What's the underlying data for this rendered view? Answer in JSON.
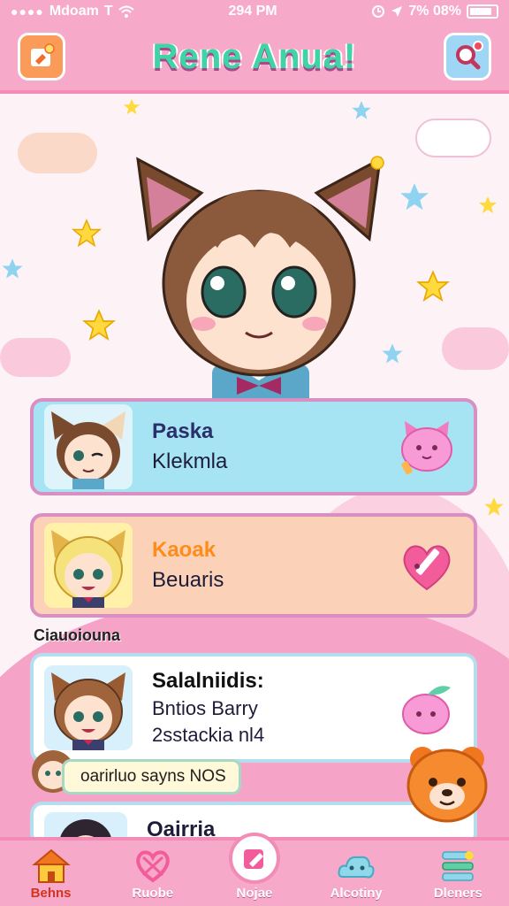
{
  "status_bar": {
    "carrier": "Mdoam",
    "carrier_mark": "T",
    "time": "294 PM",
    "battery_text": "7% 08%"
  },
  "header": {
    "title": "Rene Anua!",
    "left_icon": "edit-note-icon",
    "right_icon": "search-icon"
  },
  "cards": [
    {
      "name": "Paska",
      "subtitle": "Klekmla",
      "avatar": "cat-girl-avatar",
      "icon": "pink-cat-icon"
    },
    {
      "name": "Kaoak",
      "subtitle": "Beuaris",
      "avatar": "blonde-cat-avatar",
      "icon": "heart-pencil-icon"
    },
    {
      "name": "Salalniidis:",
      "subtitle": "Bntios Barry",
      "subtitle2": "2sstackia nl4",
      "avatar": "brown-cat-avatar",
      "icon": "peach-icon"
    },
    {
      "name": "Oairria",
      "avatar": "dark-hair-avatar"
    }
  ],
  "section_label": "Ciauoiouna",
  "speech_bubble": "oarirluo sayns NOS",
  "nav": [
    {
      "label": "Behns",
      "icon": "home-icon",
      "active": true
    },
    {
      "label": "Ruobe",
      "icon": "heart-icon",
      "active": false
    },
    {
      "label": "Nojae",
      "icon": "pencil-icon",
      "active": false
    },
    {
      "label": "Alcotiny",
      "icon": "cloud-face-icon",
      "active": false
    },
    {
      "label": "Dleners",
      "icon": "list-icon",
      "active": false
    }
  ],
  "colors": {
    "header_bg": "#f7a9c9",
    "title_green": "#3fd4a6",
    "card1": "#a7e4f3",
    "card2": "#fbd2b8",
    "active_nav": "#d2351f"
  }
}
